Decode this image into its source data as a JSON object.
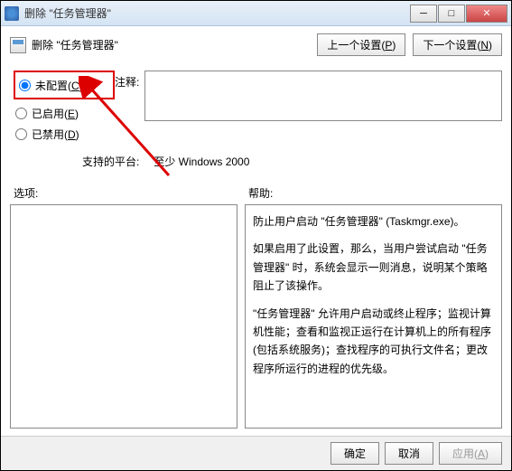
{
  "titlebar": {
    "title": "删除 \"任务管理器\""
  },
  "header": {
    "title": "删除 \"任务管理器\""
  },
  "nav": {
    "prev": "上一个设置(",
    "prev_u": "P",
    "prev_end": ")",
    "next": "下一个设置(",
    "next_u": "N",
    "next_end": ")"
  },
  "radios": {
    "unconfigured": "未配置(",
    "unconfigured_u": "C",
    "unconfigured_end": ")",
    "enabled": "已启用(",
    "enabled_u": "E",
    "enabled_end": ")",
    "disabled": "已禁用(",
    "disabled_u": "D",
    "disabled_end": ")"
  },
  "comment_label": "注释:",
  "platform": {
    "label": "支持的平台:",
    "value": "至少 Windows 2000"
  },
  "sections": {
    "options": "选项:",
    "help": "帮助:"
  },
  "help_text": {
    "p1": "防止用户启动 \"任务管理器\" (Taskmgr.exe)。",
    "p2": "如果启用了此设置，那么，当用户尝试启动 \"任务管理器\" 时，系统会显示一则消息，说明某个策略阻止了该操作。",
    "p3": "\"任务管理器\" 允许用户启动或终止程序；监视计算机性能；查看和监视正运行在计算机上的所有程序(包括系统服务)；查找程序的可执行文件名；更改程序所运行的进程的优先级。"
  },
  "footer": {
    "ok": "确定",
    "cancel": "取消",
    "apply": "应用(",
    "apply_u": "A",
    "apply_end": ")"
  }
}
